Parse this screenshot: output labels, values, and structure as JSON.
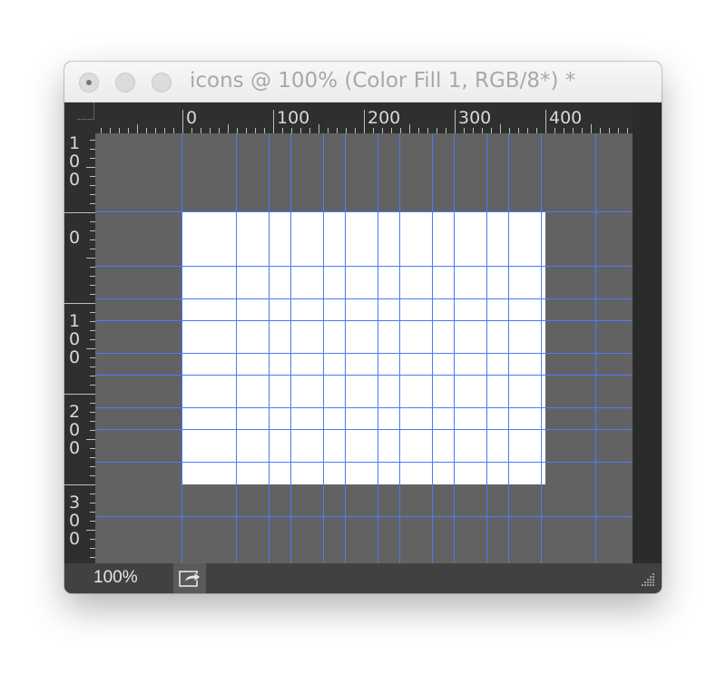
{
  "window": {
    "title": "icons @ 100% (Color Fill 1, RGB/8*) *"
  },
  "rulers": {
    "horizontal_labels": [
      "0",
      "100",
      "200",
      "300",
      "400"
    ],
    "vertical_labels": [
      "100",
      "0",
      "100",
      "200",
      "300"
    ]
  },
  "statusbar": {
    "zoom": "100%"
  },
  "colors": {
    "guide": "#4a7cf5",
    "pasteboard": "#626262",
    "document": "#ffffff",
    "ruler": "#2f2f2f"
  },
  "icons": {
    "close": "close-icon",
    "minimize": "minimize-icon",
    "zoom": "zoom-icon",
    "share": "share-icon",
    "resize": "resize-grip-icon"
  }
}
